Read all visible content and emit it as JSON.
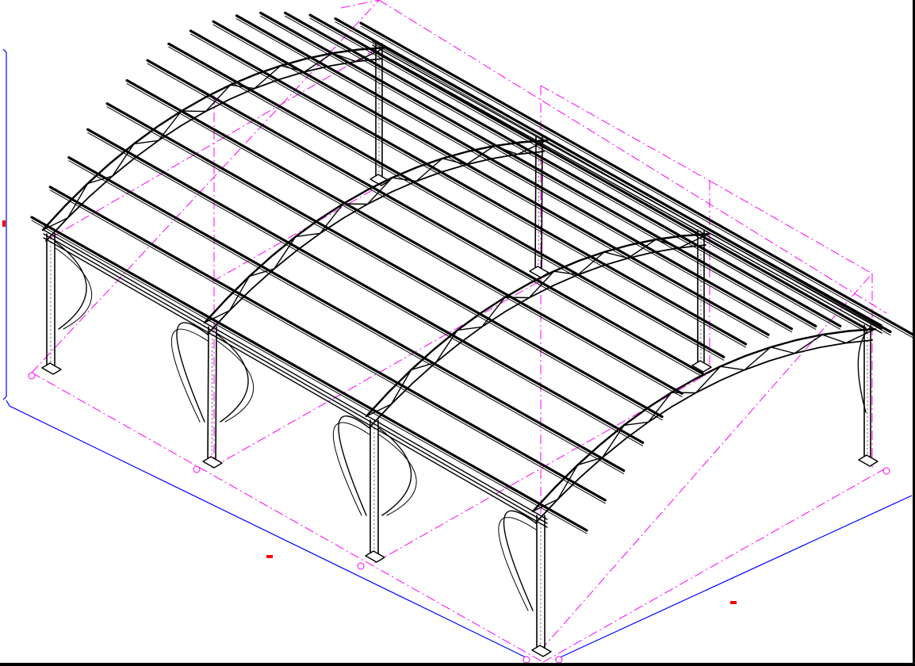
{
  "drawing": {
    "subject": "steel-roof-shelter-isometric",
    "colors": {
      "background": "#ffffff",
      "structure": "#000000",
      "grid_lines": "#ff00ff",
      "dimension_lines": "#0000ff",
      "dimension_ticks": "#ff0000"
    },
    "structure_counts": {
      "front_columns": 4,
      "back_columns": 4,
      "roof_trusses": 4,
      "purlins": 16
    },
    "icons": [
      "column-base-marker",
      "grid-bubble"
    ]
  }
}
